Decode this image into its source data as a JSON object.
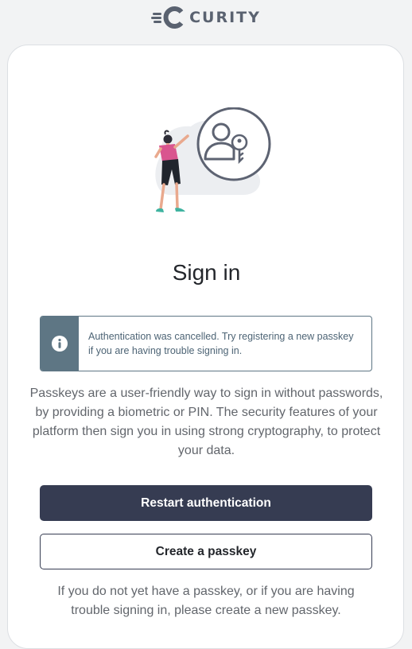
{
  "header": {
    "brand": "CURITY",
    "logo_icon": "curity-logo-icon"
  },
  "card": {
    "illustration_icon": "user-key-illustration-icon",
    "title": "Sign in",
    "alert": {
      "icon": "info-icon",
      "message": "Authentication was cancelled. Try registering a new passkey if you are having trouble signing in."
    },
    "description": "Passkeys are a user-friendly way to sign in without passwords, by providing a biometric or PIN. The security features of your platform then sign you in using strong cryptography, to protect your data.",
    "restart_label": "Restart authentication",
    "create_label": "Create a passkey",
    "hint": "If you do not yet have a passkey, or if you are having trouble signing in, please create a new passkey."
  },
  "colors": {
    "primary_button": "#363c52",
    "alert_accent": "#5e7684",
    "page_background": "#f2f3f4"
  }
}
